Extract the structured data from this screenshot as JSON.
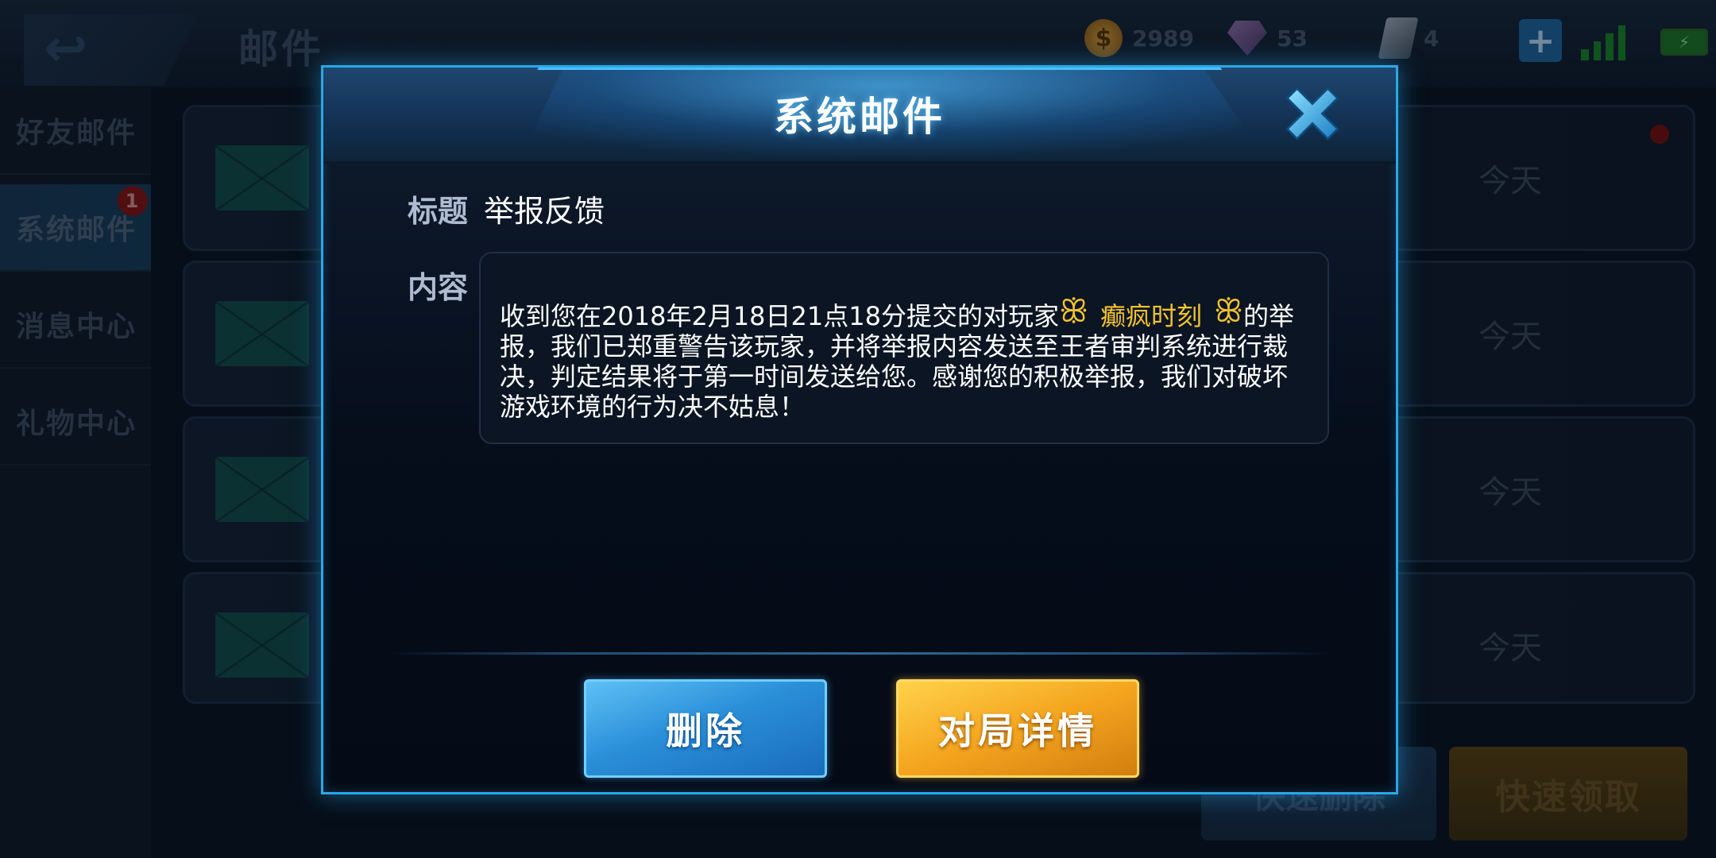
{
  "background": {
    "page_title": "邮件",
    "currencies": [
      {
        "icon": "gold-coin-icon",
        "value": "2989"
      },
      {
        "icon": "diamond-icon",
        "value": "53"
      },
      {
        "icon": "coupon-card-icon",
        "value": "4"
      }
    ],
    "sidebar": [
      {
        "label": "好友邮件"
      },
      {
        "label": "系统邮件",
        "badge": "1"
      },
      {
        "label": "消息中心"
      },
      {
        "label": "礼物中心"
      }
    ],
    "mail_list": [
      {
        "date": "今天"
      },
      {
        "date": "今天"
      },
      {
        "date": "今天"
      },
      {
        "date": "今天"
      }
    ],
    "quick_delete_label": "快速删除",
    "quick_claim_label": "快速领取"
  },
  "modal": {
    "title": "系统邮件",
    "subject_label": "标题",
    "subject_value": "举报反馈",
    "content_label": "内容",
    "content_prefix": "收到您在2018年2月18日21点18分提交的对玩家",
    "player_name": "癫疯时刻",
    "content_suffix": "的举报，我们已郑重警告该玩家，并将举报内容发送至王者审判系统进行裁决，判定结果将于第一时间发送给您。感谢您的积极举报，我们对破坏游戏环境的行为决不姑息！",
    "delete_label": "删除",
    "details_label": "对局详情"
  },
  "colors": {
    "accent_blue": "#2aa7e6",
    "player_name": "#f4c32e",
    "delete_button": "#2a8fd8",
    "details_button": "#f4a51f"
  }
}
